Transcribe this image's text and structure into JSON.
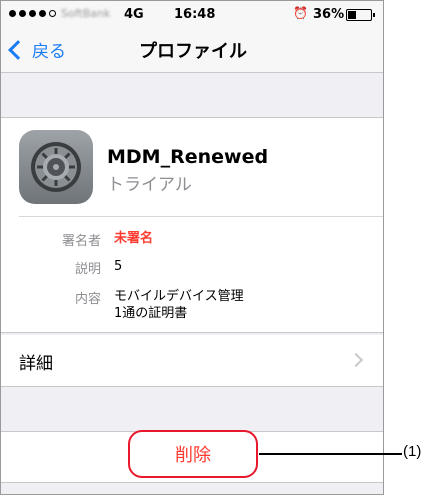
{
  "status_bar": {
    "carrier": "SoftBank",
    "network": "4G",
    "time": "16:48",
    "battery_percent": "36%",
    "battery_level": 0.36,
    "icons": [
      "signal-dots-icon",
      "alarm-icon",
      "battery-icon"
    ]
  },
  "nav": {
    "back_label": "戻る",
    "title": "プロファイル",
    "accent_color": "#1a7cf5"
  },
  "profile": {
    "icon": "settings-gear-icon",
    "name": "MDM_Renewed",
    "subtitle": "トライアル",
    "fields": [
      {
        "label": "署名者",
        "value": "未署名",
        "value_color": "#ff3b30"
      },
      {
        "label": "説明",
        "value": "5"
      },
      {
        "label": "内容",
        "value": "モバイルデバイス管理\n1通の証明書"
      }
    ]
  },
  "details": {
    "label": "詳細"
  },
  "delete": {
    "label": "削除",
    "color": "#ff3b30"
  },
  "annotation": {
    "label": "(1)"
  }
}
